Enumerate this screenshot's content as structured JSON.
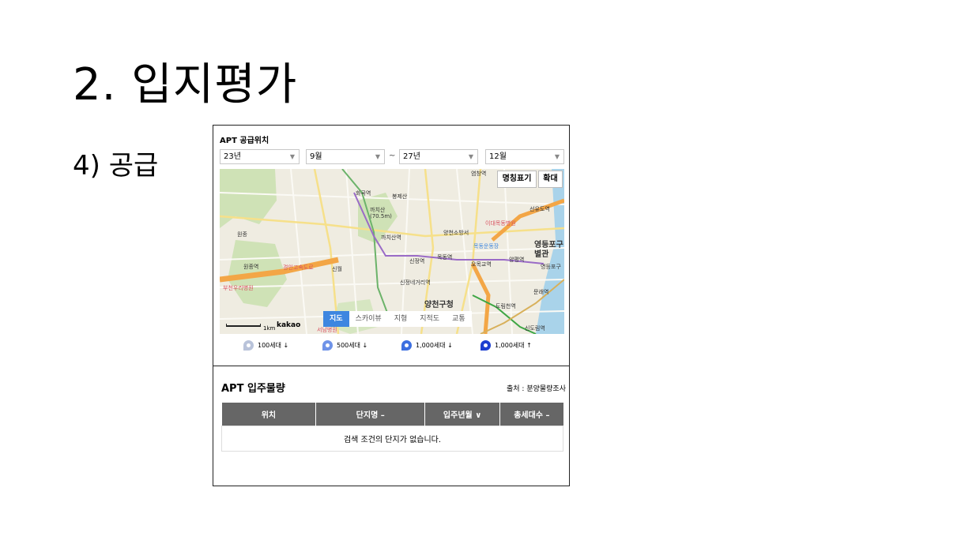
{
  "slide": {
    "title": "2. 입지평가",
    "subtitle": "4) 공급"
  },
  "panel": {
    "title": "APT 공급위치",
    "filters": {
      "start_year": "23년",
      "start_month": "9월",
      "separator": "~",
      "end_year": "27년",
      "end_month": "12월"
    },
    "map": {
      "buttons": {
        "labels": "명칭표기",
        "zoom": "확대"
      },
      "tabs": [
        "지도",
        "스카이뷰",
        "지형",
        "지적도",
        "교통"
      ],
      "scale": "1km",
      "provider": "kakao",
      "labels": {
        "hwagok": "화곡역",
        "bongjesan": "봉제산",
        "kkachisan": "까치산",
        "kkachisan_h": "(70.5m)",
        "kkachisan_stn": "까치산역",
        "yangcheon_fire": "양천소방서",
        "ewha": "이대목동병원",
        "mokdong_stadium": "목동운동장",
        "sinjeong": "신정역",
        "mokdong": "목동역",
        "omokgyo": "오목교역",
        "yangpyeong": "양평역",
        "yeongdeungpo_gu": "영등포구",
        "byeolgwan": "별관",
        "yeongdeungpo_gu2": "영등포구",
        "seonyudo": "선유도역",
        "wonjong": "원종",
        "wonjong_stn": "원종역",
        "gyeongin": "경인고속도로",
        "sinwol": "신월",
        "bucheon": "부천우리병원",
        "sinjeong_4": "신정네거리역",
        "yangcheon_office": "양천구청",
        "mullae": "문래역",
        "dorimcheon": "도림천역",
        "sindorim": "신도림역",
        "seonam": "서남병원",
        "yeomchang": "염창역"
      }
    },
    "legend": [
      "100세대 ↓",
      "500세대 ↓",
      "1,000세대 ↓",
      "1,000세대 ↑"
    ],
    "legend_colors": [
      "#b9c3da",
      "#6f93e8",
      "#3d6fe0",
      "#1c3fd0"
    ],
    "move_in": {
      "title": "APT 입주물량",
      "source": "출처 : 분양물량조사",
      "columns": [
        "위치",
        "단지명 –",
        "입주년월 ∨",
        "총세대수 –"
      ],
      "empty_message": "검색 조건의 단지가 없습니다."
    }
  }
}
